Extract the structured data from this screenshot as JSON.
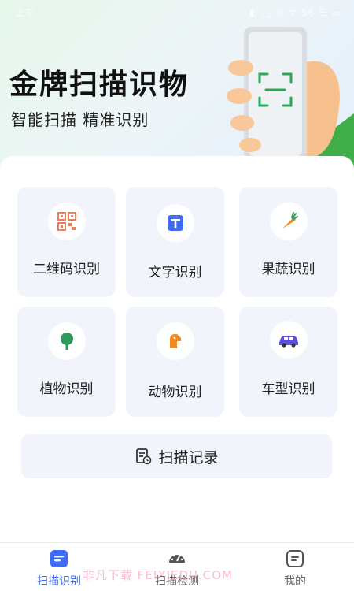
{
  "status_bar": {
    "time": "上午",
    "icons": "◐ ▢ ✉ ᯤ 56 ☰ ▭"
  },
  "hero": {
    "title": "金牌扫描识物",
    "subtitle": "智能扫描 精准识别"
  },
  "tiles": [
    {
      "label": "二维码识别",
      "icon": "qr-code-icon",
      "color": "#ef7d57"
    },
    {
      "label": "文字识别",
      "icon": "text-icon",
      "color": "#3e6cf6"
    },
    {
      "label": "果蔬识别",
      "icon": "carrot-icon",
      "color": "#f08a24"
    },
    {
      "label": "植物识别",
      "icon": "tree-icon",
      "color": "#2e9a5c"
    },
    {
      "label": "动物识别",
      "icon": "dog-icon",
      "color": "#f08a24"
    },
    {
      "label": "车型识别",
      "icon": "car-icon",
      "color": "#5b4fe0"
    }
  ],
  "history": {
    "label": "扫描记录"
  },
  "tabs": [
    {
      "label": "扫描识别",
      "active": true
    },
    {
      "label": "扫描检测",
      "active": false
    },
    {
      "label": "我的",
      "active": false
    }
  ],
  "watermark": "非凡下载 FEIXIEDU.COM",
  "colors": {
    "accent": "#3e6cf6",
    "scan_green": "#2ea55a"
  }
}
